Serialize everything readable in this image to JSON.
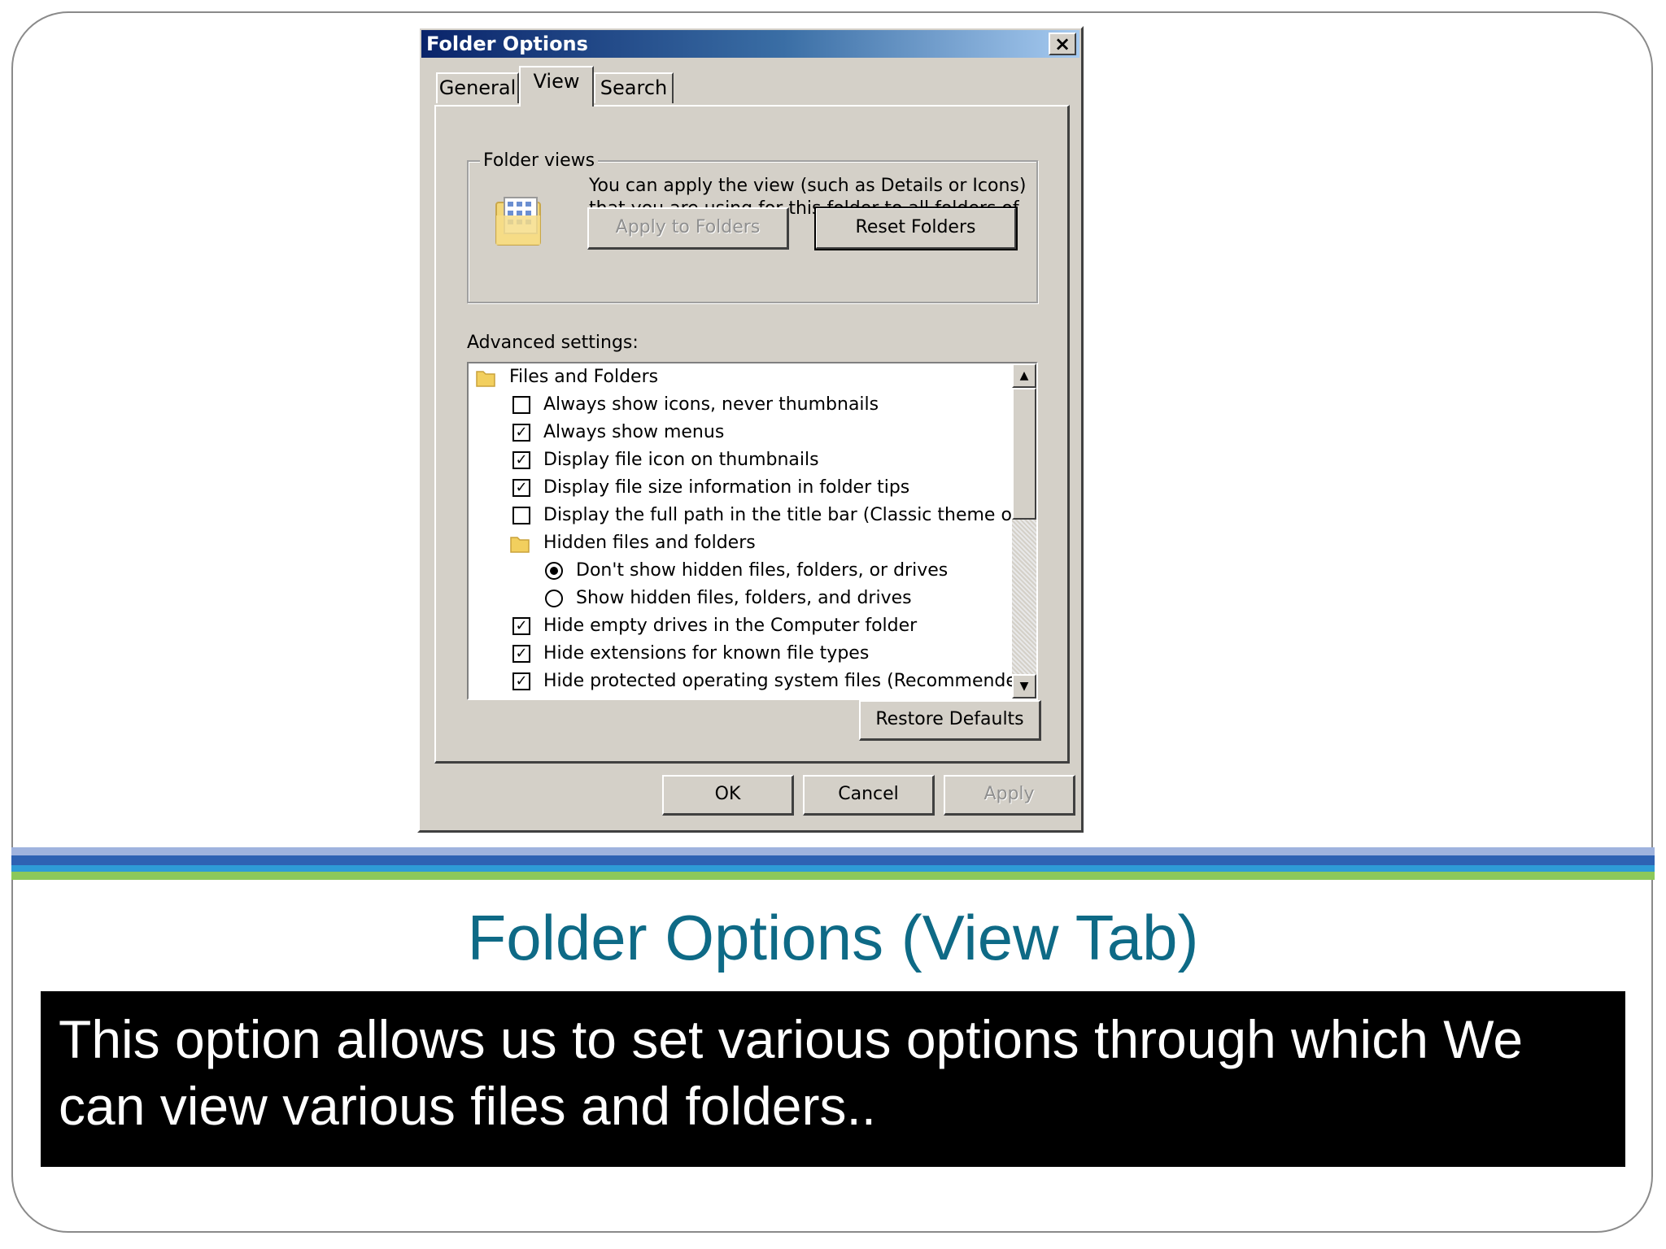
{
  "dialog": {
    "title": "Folder Options",
    "close_label": "×",
    "tabs": [
      {
        "label": "General"
      },
      {
        "label": "View",
        "active": true
      },
      {
        "label": "Search"
      }
    ],
    "folder_views": {
      "legend": "Folder views",
      "description": "You can apply the view (such as Details or Icons) that you are using for this folder to all folders of this type.",
      "apply_button": "Apply to Folders",
      "reset_button": "Reset Folders"
    },
    "advanced_label": "Advanced settings:",
    "advanced_items": [
      {
        "type": "folder",
        "label": "Files and Folders"
      },
      {
        "type": "checkbox",
        "checked": false,
        "label": "Always show icons, never thumbnails"
      },
      {
        "type": "checkbox",
        "checked": true,
        "label": "Always show menus"
      },
      {
        "type": "checkbox",
        "checked": true,
        "label": "Display file icon on thumbnails"
      },
      {
        "type": "checkbox",
        "checked": true,
        "label": "Display file size information in folder tips"
      },
      {
        "type": "checkbox",
        "checked": false,
        "label": "Display the full path in the title bar (Classic theme only)"
      },
      {
        "type": "folder",
        "label": "Hidden files and folders"
      },
      {
        "type": "radio",
        "checked": true,
        "label": "Don't show hidden files, folders, or drives"
      },
      {
        "type": "radio",
        "checked": false,
        "label": "Show hidden files, folders, and drives"
      },
      {
        "type": "checkbox",
        "checked": true,
        "label": "Hide empty drives in the Computer folder"
      },
      {
        "type": "checkbox",
        "checked": true,
        "label": "Hide extensions for known file types"
      },
      {
        "type": "checkbox",
        "checked": true,
        "label": "Hide protected operating system files (Recommended)"
      }
    ],
    "restore_defaults": "Restore Defaults",
    "ok": "OK",
    "cancel": "Cancel",
    "apply": "Apply"
  },
  "slide": {
    "title": "Folder Options (View Tab)",
    "description": "This option allows us to set various options through which We can view various files and folders.."
  },
  "icons": {
    "up_arrow": "▲",
    "down_arrow": "▼",
    "check": "✓"
  }
}
